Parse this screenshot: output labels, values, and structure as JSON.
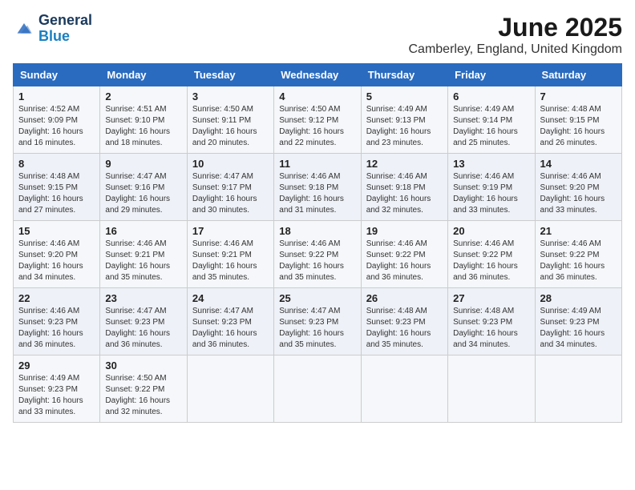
{
  "header": {
    "logo_line1": "General",
    "logo_line2": "Blue",
    "title": "June 2025",
    "subtitle": "Camberley, England, United Kingdom"
  },
  "weekdays": [
    "Sunday",
    "Monday",
    "Tuesday",
    "Wednesday",
    "Thursday",
    "Friday",
    "Saturday"
  ],
  "weeks": [
    [
      {
        "day": "1",
        "info": "Sunrise: 4:52 AM\nSunset: 9:09 PM\nDaylight: 16 hours\nand 16 minutes."
      },
      {
        "day": "2",
        "info": "Sunrise: 4:51 AM\nSunset: 9:10 PM\nDaylight: 16 hours\nand 18 minutes."
      },
      {
        "day": "3",
        "info": "Sunrise: 4:50 AM\nSunset: 9:11 PM\nDaylight: 16 hours\nand 20 minutes."
      },
      {
        "day": "4",
        "info": "Sunrise: 4:50 AM\nSunset: 9:12 PM\nDaylight: 16 hours\nand 22 minutes."
      },
      {
        "day": "5",
        "info": "Sunrise: 4:49 AM\nSunset: 9:13 PM\nDaylight: 16 hours\nand 23 minutes."
      },
      {
        "day": "6",
        "info": "Sunrise: 4:49 AM\nSunset: 9:14 PM\nDaylight: 16 hours\nand 25 minutes."
      },
      {
        "day": "7",
        "info": "Sunrise: 4:48 AM\nSunset: 9:15 PM\nDaylight: 16 hours\nand 26 minutes."
      }
    ],
    [
      {
        "day": "8",
        "info": "Sunrise: 4:48 AM\nSunset: 9:15 PM\nDaylight: 16 hours\nand 27 minutes."
      },
      {
        "day": "9",
        "info": "Sunrise: 4:47 AM\nSunset: 9:16 PM\nDaylight: 16 hours\nand 29 minutes."
      },
      {
        "day": "10",
        "info": "Sunrise: 4:47 AM\nSunset: 9:17 PM\nDaylight: 16 hours\nand 30 minutes."
      },
      {
        "day": "11",
        "info": "Sunrise: 4:46 AM\nSunset: 9:18 PM\nDaylight: 16 hours\nand 31 minutes."
      },
      {
        "day": "12",
        "info": "Sunrise: 4:46 AM\nSunset: 9:18 PM\nDaylight: 16 hours\nand 32 minutes."
      },
      {
        "day": "13",
        "info": "Sunrise: 4:46 AM\nSunset: 9:19 PM\nDaylight: 16 hours\nand 33 minutes."
      },
      {
        "day": "14",
        "info": "Sunrise: 4:46 AM\nSunset: 9:20 PM\nDaylight: 16 hours\nand 33 minutes."
      }
    ],
    [
      {
        "day": "15",
        "info": "Sunrise: 4:46 AM\nSunset: 9:20 PM\nDaylight: 16 hours\nand 34 minutes."
      },
      {
        "day": "16",
        "info": "Sunrise: 4:46 AM\nSunset: 9:21 PM\nDaylight: 16 hours\nand 35 minutes."
      },
      {
        "day": "17",
        "info": "Sunrise: 4:46 AM\nSunset: 9:21 PM\nDaylight: 16 hours\nand 35 minutes."
      },
      {
        "day": "18",
        "info": "Sunrise: 4:46 AM\nSunset: 9:22 PM\nDaylight: 16 hours\nand 35 minutes."
      },
      {
        "day": "19",
        "info": "Sunrise: 4:46 AM\nSunset: 9:22 PM\nDaylight: 16 hours\nand 36 minutes."
      },
      {
        "day": "20",
        "info": "Sunrise: 4:46 AM\nSunset: 9:22 PM\nDaylight: 16 hours\nand 36 minutes."
      },
      {
        "day": "21",
        "info": "Sunrise: 4:46 AM\nSunset: 9:22 PM\nDaylight: 16 hours\nand 36 minutes."
      }
    ],
    [
      {
        "day": "22",
        "info": "Sunrise: 4:46 AM\nSunset: 9:23 PM\nDaylight: 16 hours\nand 36 minutes."
      },
      {
        "day": "23",
        "info": "Sunrise: 4:47 AM\nSunset: 9:23 PM\nDaylight: 16 hours\nand 36 minutes."
      },
      {
        "day": "24",
        "info": "Sunrise: 4:47 AM\nSunset: 9:23 PM\nDaylight: 16 hours\nand 36 minutes."
      },
      {
        "day": "25",
        "info": "Sunrise: 4:47 AM\nSunset: 9:23 PM\nDaylight: 16 hours\nand 35 minutes."
      },
      {
        "day": "26",
        "info": "Sunrise: 4:48 AM\nSunset: 9:23 PM\nDaylight: 16 hours\nand 35 minutes."
      },
      {
        "day": "27",
        "info": "Sunrise: 4:48 AM\nSunset: 9:23 PM\nDaylight: 16 hours\nand 34 minutes."
      },
      {
        "day": "28",
        "info": "Sunrise: 4:49 AM\nSunset: 9:23 PM\nDaylight: 16 hours\nand 34 minutes."
      }
    ],
    [
      {
        "day": "29",
        "info": "Sunrise: 4:49 AM\nSunset: 9:23 PM\nDaylight: 16 hours\nand 33 minutes."
      },
      {
        "day": "30",
        "info": "Sunrise: 4:50 AM\nSunset: 9:22 PM\nDaylight: 16 hours\nand 32 minutes."
      },
      {
        "day": "",
        "info": ""
      },
      {
        "day": "",
        "info": ""
      },
      {
        "day": "",
        "info": ""
      },
      {
        "day": "",
        "info": ""
      },
      {
        "day": "",
        "info": ""
      }
    ]
  ]
}
